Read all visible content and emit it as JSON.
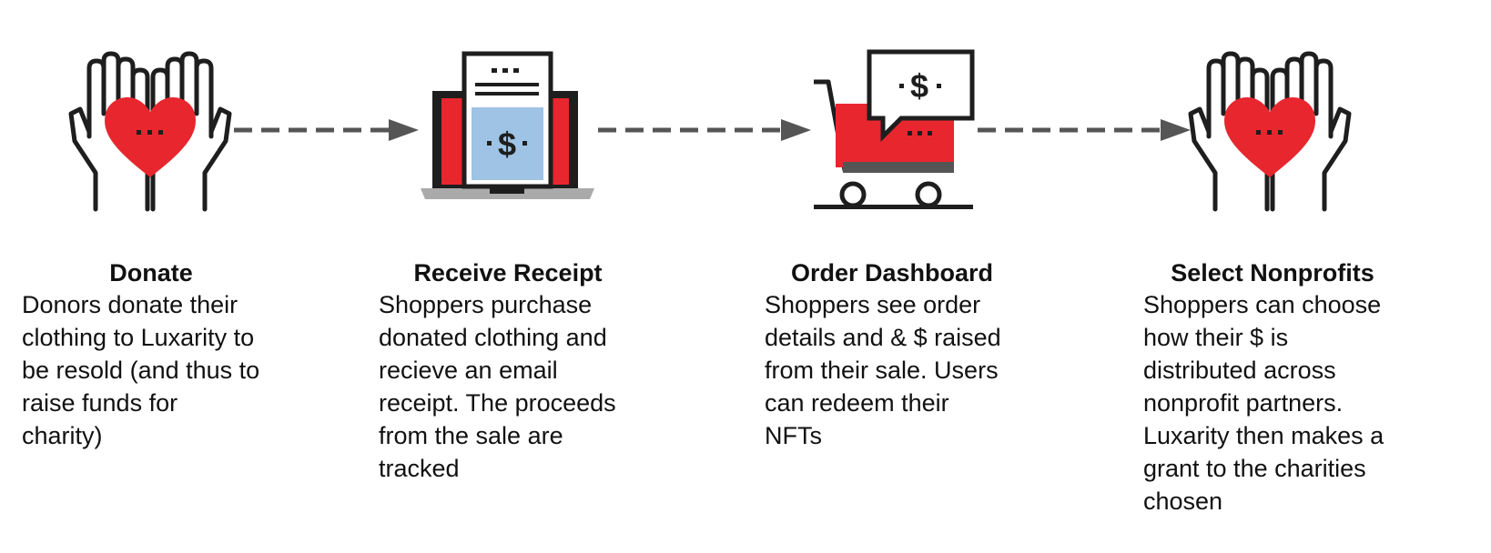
{
  "colors": {
    "accent_red": "#E8262E",
    "outline": "#1E1E1E",
    "arrow": "#555555",
    "receipt_blue": "#9EC3E4",
    "laptop_base": "#AAAAAA"
  },
  "steps": [
    {
      "icon": "hands-heart-icon",
      "title": "Donate",
      "description": "Donors donate their\nclothing to Luxarity to\nbe resold (and thus to\nraise funds for\ncharity)"
    },
    {
      "icon": "laptop-receipt-icon",
      "title": "Receive Receipt",
      "description": "Shoppers purchase\ndonated clothing and\nrecieve an email\nreceipt. The proceeds\nfrom the sale are\ntracked"
    },
    {
      "icon": "shopping-cart-dollar-icon",
      "title": "Order Dashboard",
      "description": "Shoppers see order\ndetails and & $ raised\nfrom their sale. Users\ncan redeem their\nNFTs"
    },
    {
      "icon": "hands-heart-icon",
      "title": "Select Nonprofits",
      "description": "Shoppers can choose\nhow their $ is\ndistributed across\nnonprofit partners.\nLuxarity then makes a\ngrant to the charities\nchosen"
    }
  ]
}
